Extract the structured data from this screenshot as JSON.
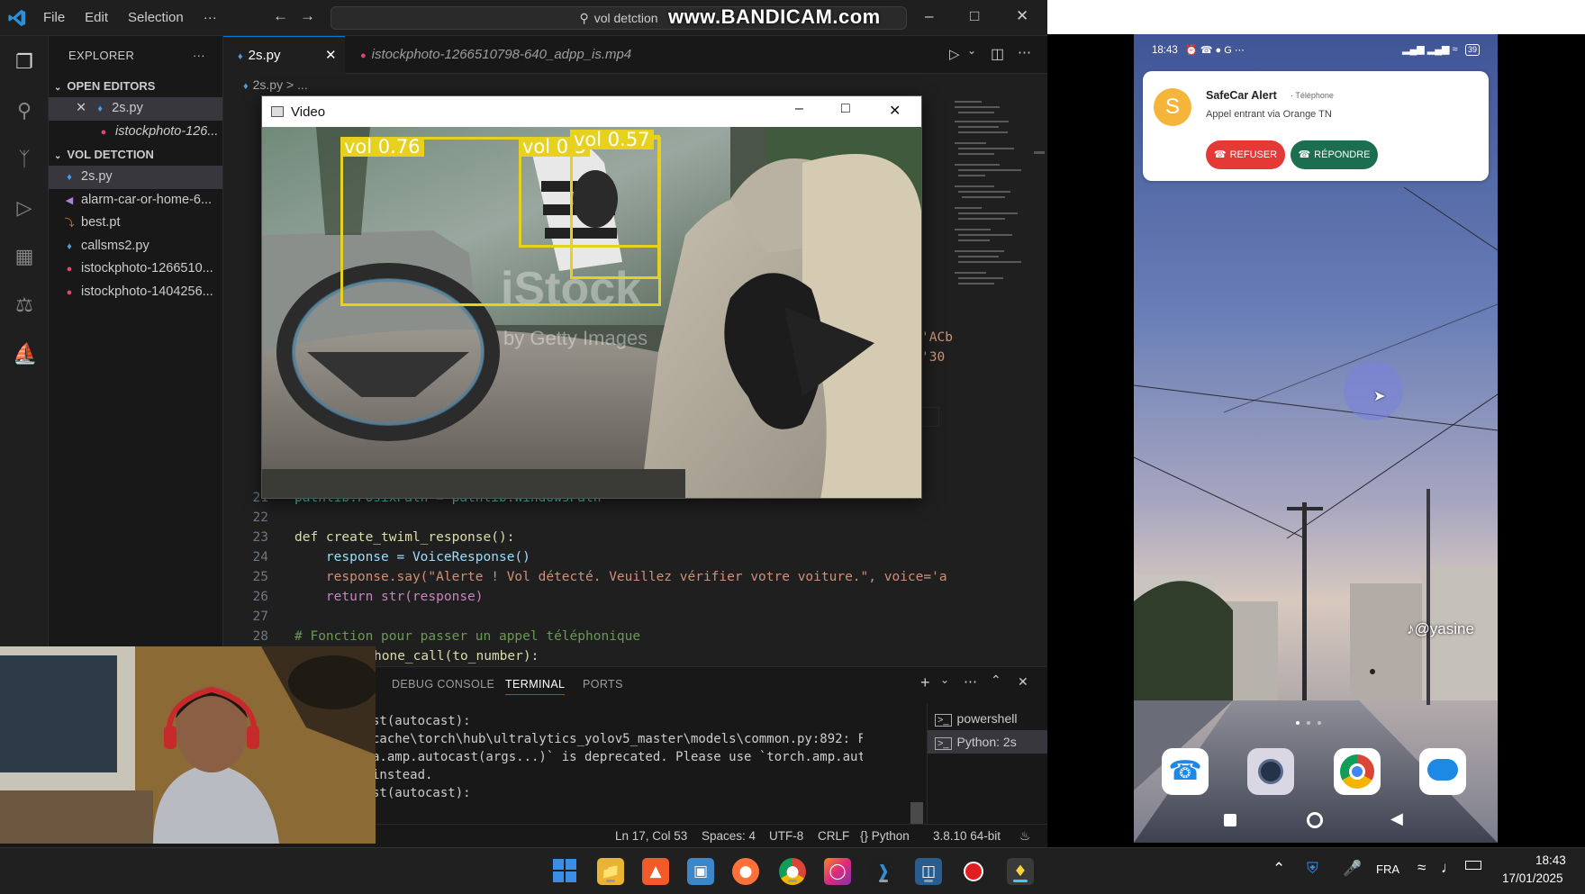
{
  "watermark": "www.BANDICAM.com",
  "vscode": {
    "menu": [
      "File",
      "Edit",
      "Selection",
      "···"
    ],
    "search": "vol detction",
    "explorer": {
      "title": "EXPLORER",
      "more": "···",
      "open_editors_label": "OPEN EDITORS",
      "open_editors": [
        "2s.py",
        "istockphoto-126..."
      ],
      "folder_label": "VOL DETCTION",
      "files": [
        "2s.py",
        "alarm-car-or-home-6...",
        "best.pt",
        "callsms2.py",
        "istockphoto-1266510...",
        "istockphoto-1404256..."
      ]
    },
    "tabs": [
      "2s.py",
      "istockphoto-1266510798-640_adpp_is.mp4"
    ],
    "breadcrumb": "2s.py > ...",
    "gutter_digits": [
      "1",
      "1",
      "1",
      "1",
      "1",
      "1",
      "1",
      "1",
      "1"
    ],
    "partial_strings": [
      "'ACb",
      "'30"
    ],
    "code_lines": [
      {
        "num": "21",
        "text": "pathlib.PosixPath = pathlib.WindowsPath"
      },
      {
        "num": "22",
        "text": ""
      },
      {
        "num": "23",
        "text": "def create_twiml_response():"
      },
      {
        "num": "24",
        "text": "    response = VoiceResponse()"
      },
      {
        "num": "25",
        "text": "    response.say(\"Alerte ! Vol détecté. Veuillez vérifier votre voiture.\", voice='a"
      },
      {
        "num": "26",
        "text": "    return str(response)"
      },
      {
        "num": "27",
        "text": ""
      },
      {
        "num": "28",
        "text": "# Fonction pour passer un appel téléphonique"
      },
      {
        "num": "",
        "text": "hone_call(to_number):"
      }
    ],
    "panel": {
      "tabs": [
        "DEBUG CONSOLE",
        "TERMINAL",
        "PORTS"
      ],
      "terminal_lines": [
        "st(autocast):",
        "cache\\torch\\hub\\ultralytics_yolov5_master\\models\\common.py:892: FutureWa",
        "a.amp.autocast(args...)` is deprecated. Please use `torch.amp.autocast('",
        "instead.",
        "st(autocast):"
      ],
      "shells": [
        "powershell",
        "Python: 2s"
      ]
    },
    "status": {
      "position": "Ln 17, Col 53",
      "spaces": "Spaces: 4",
      "encoding": "UTF-8",
      "eol": "CRLF",
      "language": "{} Python",
      "interpreter": "3.8.10 64-bit"
    }
  },
  "video_window": {
    "title": "Video",
    "watermark": "iStock",
    "watermark_sub": "by Getty Images",
    "detections": [
      {
        "label": "vol  0.76"
      },
      {
        "label": "vol  0.5"
      },
      {
        "label": "vol  0.57"
      }
    ]
  },
  "phone": {
    "time": "18:43",
    "battery": "39",
    "notification": {
      "avatar": "S",
      "app": "SafeCar Alert",
      "source": "· Téléphone",
      "text": "Appel entrant via Orange TN",
      "decline": "REFUSER",
      "accept": "RÉPONDRE"
    },
    "tiktok_tag": "@yasine",
    "dock": [
      "phone-app-icon",
      "camera-app-icon",
      "chrome-app-icon",
      "messages-app-icon"
    ]
  },
  "taskbar": {
    "language": "FRA",
    "time": "18:43",
    "date": "17/01/2025"
  },
  "colors": {
    "vscode_bg": "#1f1f1f",
    "accent": "#0078d4",
    "detection": "#e6d21e",
    "decline": "#e53935",
    "accept": "#1b6e4f"
  }
}
